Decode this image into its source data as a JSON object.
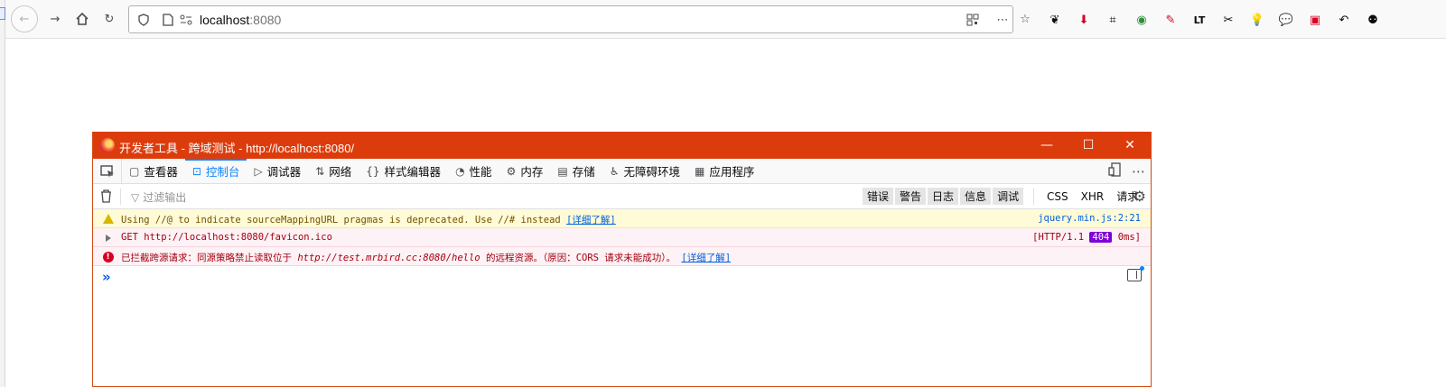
{
  "browser": {
    "url_host": "localhost",
    "url_port": ":8080",
    "icons": [
      "back-icon",
      "forward-icon",
      "home-icon",
      "reload-icon",
      "shield-icon",
      "page-icon",
      "permissions-icon",
      "qr-icon",
      "more-icon",
      "star-icon"
    ],
    "extensions": [
      "❦",
      "⬇",
      "⌗",
      "◉",
      "✎",
      "LT",
      "✂",
      "💡",
      "💬",
      "▣",
      "↶",
      "⚉"
    ]
  },
  "devtools": {
    "window_title": "开发者工具 - 跨域测试 - http://localhost:8080/",
    "tabs": [
      {
        "label": "查看器",
        "icon": "▢"
      },
      {
        "label": "控制台",
        "icon": "⊡"
      },
      {
        "label": "调试器",
        "icon": "▷"
      },
      {
        "label": "网络",
        "icon": "⇅"
      },
      {
        "label": "样式编辑器",
        "icon": "{}"
      },
      {
        "label": "性能",
        "icon": "◔"
      },
      {
        "label": "内存",
        "icon": "⚙"
      },
      {
        "label": "存储",
        "icon": "▤"
      },
      {
        "label": "无障碍环境",
        "icon": "♿"
      },
      {
        "label": "应用程序",
        "icon": "▦"
      }
    ],
    "selected_tab": "控制台",
    "filter_placeholder": "过滤输出",
    "levels": [
      "错误",
      "警告",
      "日志",
      "信息",
      "调试"
    ],
    "request_filters": [
      "CSS",
      "XHR",
      "请求"
    ],
    "messages": {
      "warning": {
        "text": "Using //@ to indicate sourceMappingURL pragmas is deprecated. Use //# instead",
        "link": "[详细了解]",
        "location": "jquery.min.js:2:21"
      },
      "network": {
        "text": "GET http://localhost:8080/favicon.ico",
        "protocol": "[HTTP/1.1",
        "status": "404",
        "timing": "0ms]"
      },
      "error": {
        "prefix": "已拦截跨源请求：同源策略禁止读取位于 ",
        "url": "http://test.mrbird.cc:8080/hello",
        "suffix": " 的远程资源。（原因：CORS 请求未能成功）。",
        "link": "[详细了解]"
      }
    },
    "prompt_symbol": "»"
  },
  "colors": {
    "titlebar": "#dc3c0c",
    "accent": "#0a84ff",
    "warning_bg": "#fffbd6",
    "error_bg": "#fdf2f5",
    "status_404": "#8000d7"
  }
}
